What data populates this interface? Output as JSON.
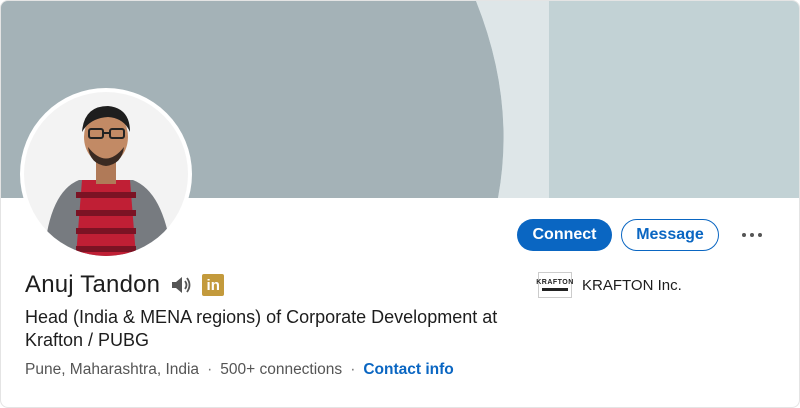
{
  "profile": {
    "name": "Anuj Tandon",
    "headline": "Head (India & MENA regions) of Corporate Development at Krafton / PUBG",
    "location": "Pune, Maharashtra, India",
    "connections": "500+ connections",
    "contact_info": "Contact info",
    "separator": "·"
  },
  "actions": {
    "connect_label": "Connect",
    "message_label": "Message"
  },
  "company": {
    "name": "KRAFTON Inc.",
    "logo_text": "KRAFTON"
  },
  "icons": {
    "speaker": "speaker-icon",
    "linkedin_premium": "in",
    "more": "more-icon"
  },
  "colors": {
    "banner_dark": "#a4b2b7",
    "banner_light": "#c2d2d5",
    "primary": "#0a66c2",
    "premium_gold": "#c39a3c"
  }
}
